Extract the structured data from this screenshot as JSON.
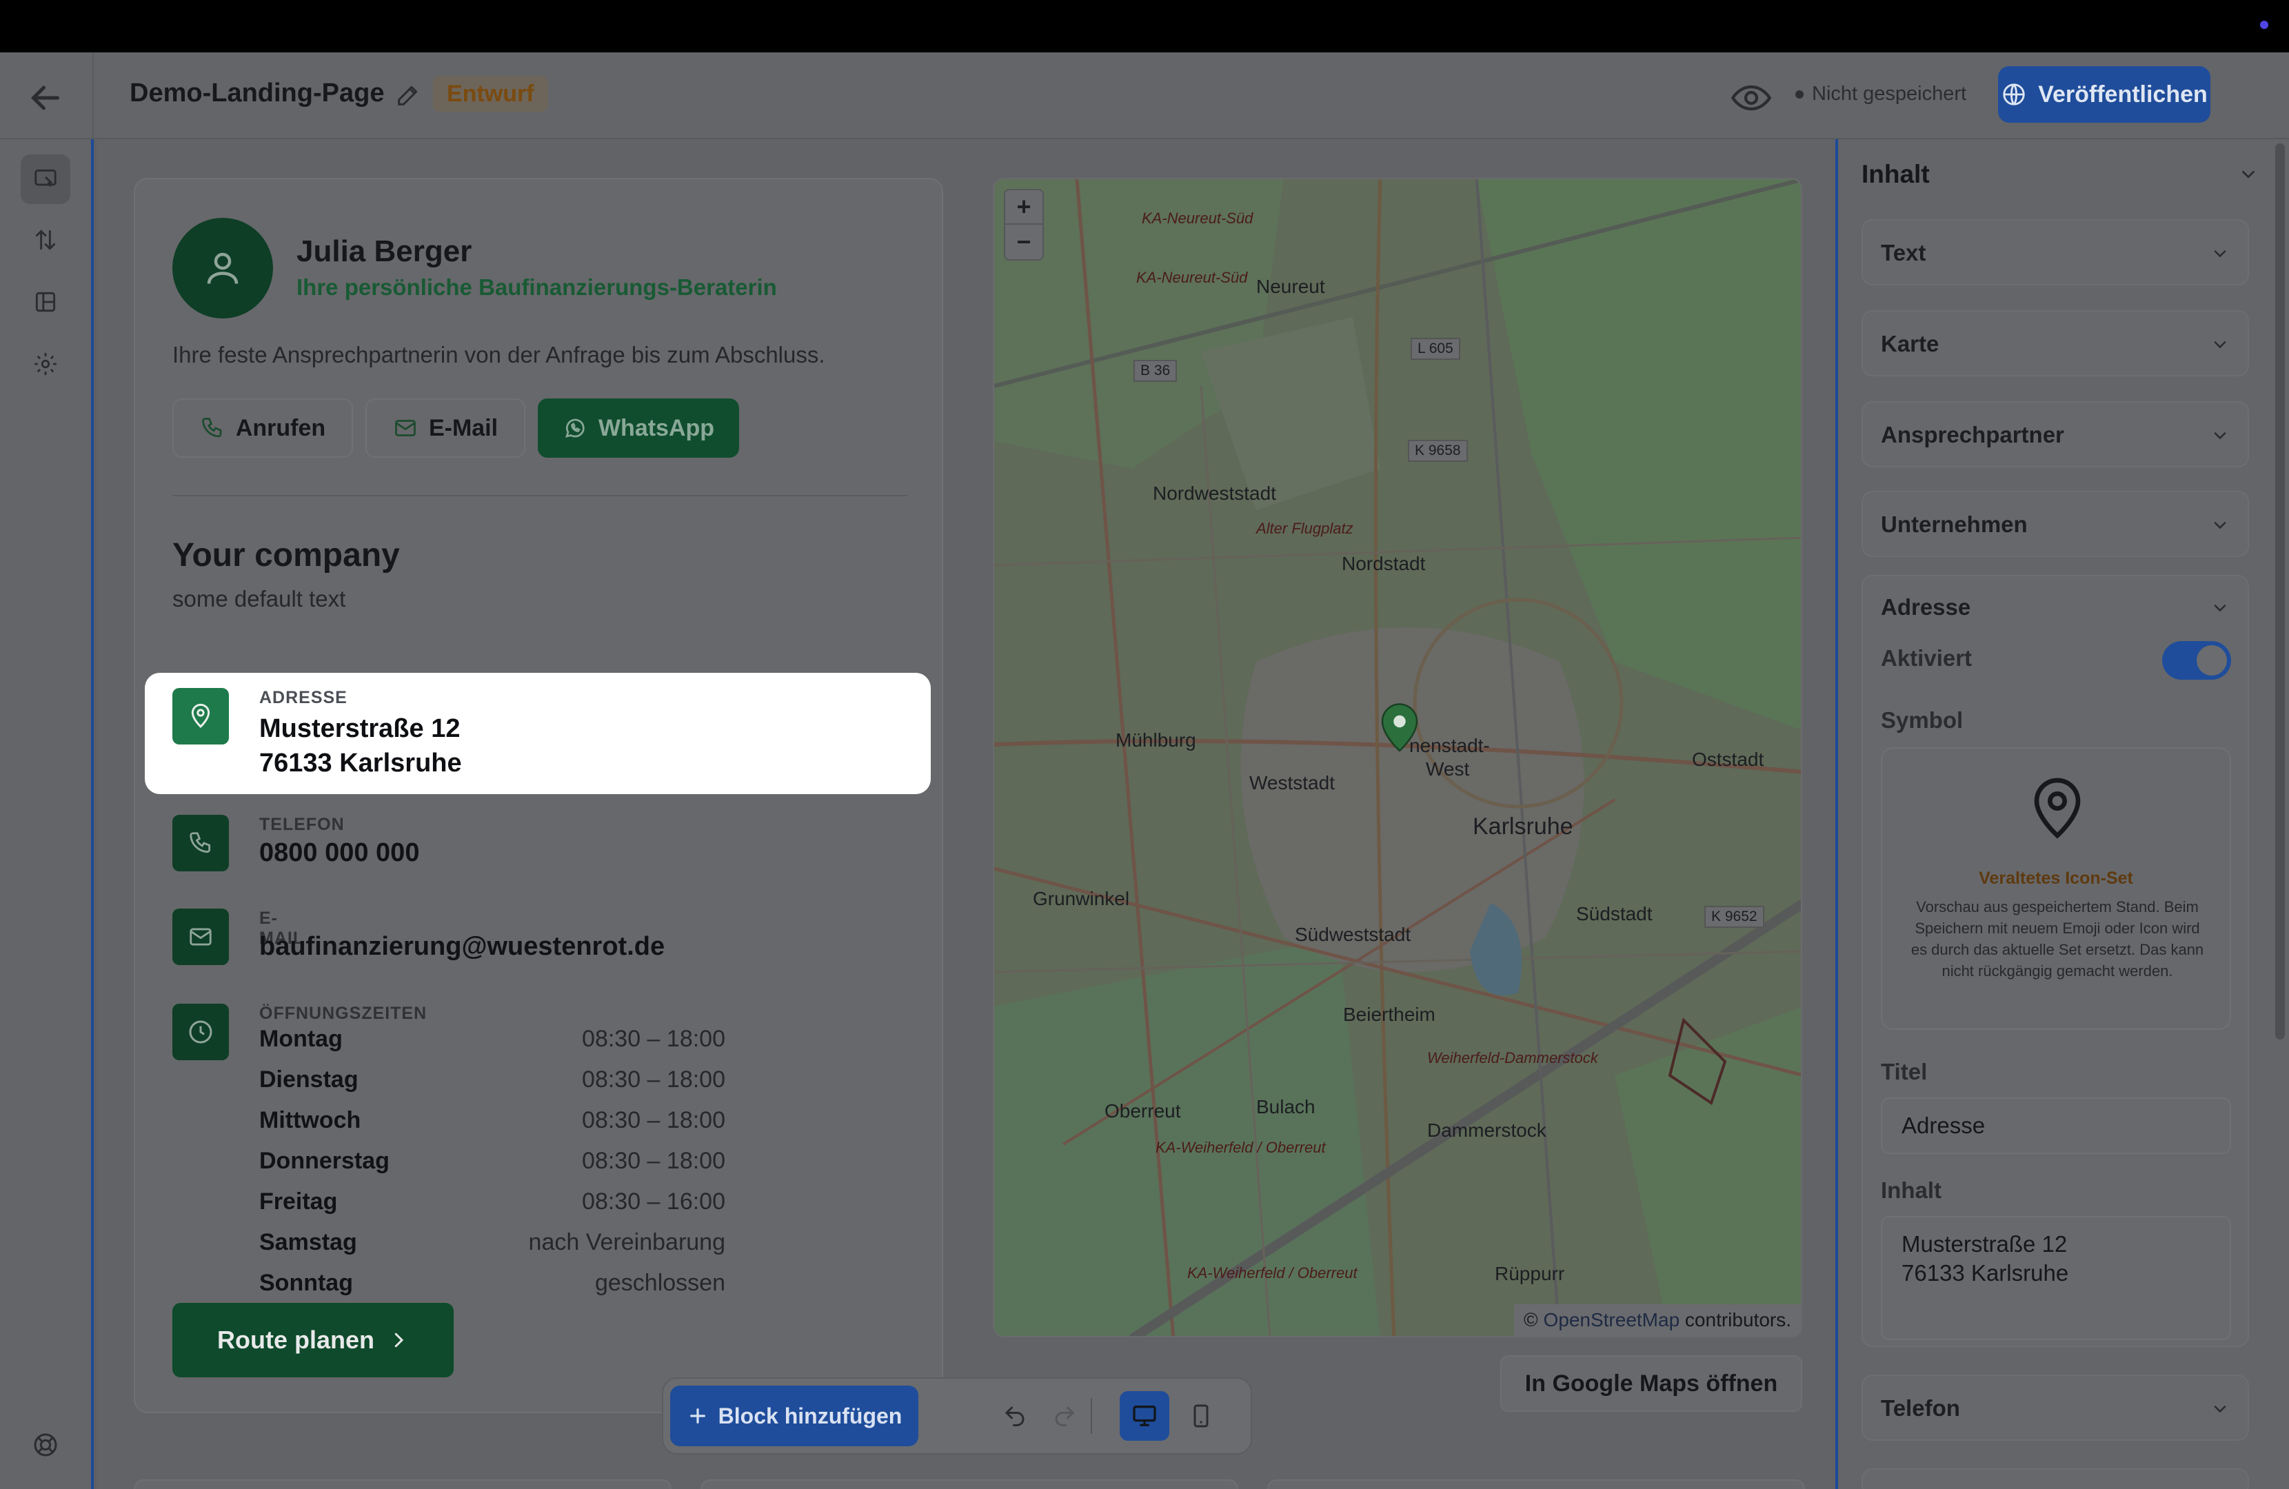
{
  "header": {
    "page_name": "Demo-Landing-Page",
    "status_badge": "Entwurf",
    "save_status": "Nicht gespeichert",
    "publish_label": "Veröffentlichen"
  },
  "sidebar": {
    "items": [
      {
        "icon": "pages-icon"
      },
      {
        "icon": "sort-icon"
      },
      {
        "icon": "layout-icon"
      },
      {
        "icon": "gear-icon"
      }
    ],
    "footer_icon": "help-icon"
  },
  "contact": {
    "name": "Julia Berger",
    "role": "Ihre persönliche Baufinanzierungs-Beraterin",
    "description": "Ihre feste Ansprechpartnerin von der Anfrage bis zum Abschluss.",
    "actions": {
      "call": "Anrufen",
      "email": "E-Mail",
      "whatsapp": "WhatsApp"
    }
  },
  "company": {
    "name": "Your company",
    "text": "some default text"
  },
  "address": {
    "label": "ADRESSE",
    "line1": "Musterstraße 12",
    "line2": "76133 Karlsruhe"
  },
  "phone": {
    "label": "TELEFON",
    "value": "0800 000 000"
  },
  "email": {
    "label": "E-MAIL",
    "value": "baufinanzierung@wuestenrot.de"
  },
  "hours": {
    "label": "ÖFFNUNGSZEITEN",
    "rows": [
      {
        "day": "Montag",
        "time": "08:30 – 18:00"
      },
      {
        "day": "Dienstag",
        "time": "08:30 – 18:00"
      },
      {
        "day": "Mittwoch",
        "time": "08:30 – 18:00"
      },
      {
        "day": "Donnerstag",
        "time": "08:30 – 18:00"
      },
      {
        "day": "Freitag",
        "time": "08:30 – 16:00"
      },
      {
        "day": "Samstag",
        "time": "nach Vereinbarung"
      },
      {
        "day": "Sonntag",
        "time": "geschlossen"
      }
    ]
  },
  "route_button": "Route planen",
  "map": {
    "zoom_in": "+",
    "zoom_out": "−",
    "attribution_symbol": "©",
    "attribution_link": "OpenStreetMap",
    "attribution_rest": " contributors.",
    "labels": {
      "neureut": "Neureut",
      "nordweststadt": "Nordweststadt",
      "nordstadt": "Nordstadt",
      "muehlburg": "Mühlburg",
      "weststadt": "Weststadt",
      "innenstadt": "nenstadt-",
      "west": "West",
      "karlsruhe": "Karlsruhe",
      "oststadt": "Oststadt",
      "grunwinkel": "Grunwinkel",
      "suedweststadt": "Südweststadt",
      "suedstadt": "Südstadt",
      "beiertheim": "Beiertheim",
      "oberreut": "Oberreut",
      "bulach": "Bulach",
      "dammerstock": "Dammerstock",
      "rueppurr": "Rüppurr",
      "road_b36": "B 36",
      "road_l605": "L 605",
      "road_k9658": "K 9658",
      "road_k9652": "K 9652",
      "ka_neureut_sued": "KA-Neureut-Süd",
      "alter_flugplatz": "Alter Flugplatz",
      "ka_weiherfeld": "KA-Weiherfeld / Oberreut",
      "weiherfeld_dammerstock": "Weiherfeld-Dammerstock"
    }
  },
  "gmaps_button": "In Google Maps öffnen",
  "toolbar": {
    "add_block": "Block hinzufügen"
  },
  "panel": {
    "title": "Inhalt",
    "sections": [
      "Text",
      "Karte",
      "Ansprechpartner",
      "Unternehmen"
    ],
    "adresse": {
      "title": "Adresse",
      "enabled_label": "Aktiviert",
      "enabled": true,
      "symbol_label": "Symbol",
      "legacy_title": "Veraltetes Icon-Set",
      "legacy_text": "Vorschau aus gespeichertem Stand. Beim Speichern mit neuem Emoji oder Icon wird es durch das aktuelle Set ersetzt. Das kann nicht rückgängig gemacht werden.",
      "titel_label": "Titel",
      "titel_value": "Adresse",
      "inhalt_label": "Inhalt",
      "inhalt_value": "Musterstraße 12\n76133 Karlsruhe"
    },
    "telefon": "Telefon"
  },
  "colors": {
    "primary_blue": "#1f4d9b",
    "brand_green": "#0e3e26",
    "overlay": "#646568"
  }
}
